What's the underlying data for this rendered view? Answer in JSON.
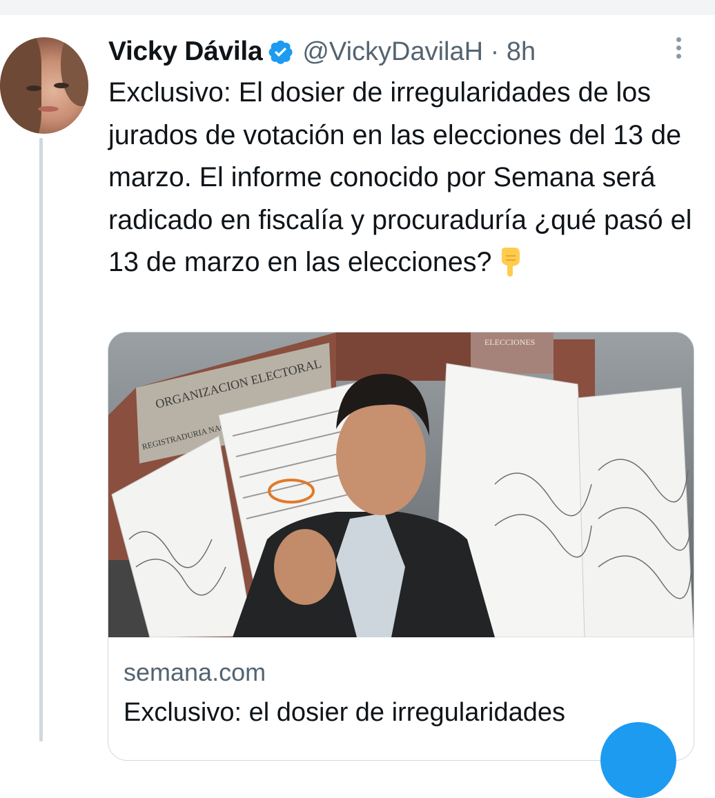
{
  "tweet": {
    "author_name": "Vicky Dávila",
    "handle_time": "@VickyDavilaH · 8h",
    "text": "Exclusivo: El dosier de irregularidades de los jurados de votación en las elecciones del 13 de marzo. El informe conocido por Semana será radicado en fiscalía y procuraduría ¿qué pasó el 13 de marzo en las elecciones?",
    "emoji": "pointing-down-emoji"
  },
  "card": {
    "image_sign_1": "ORGANIZACION ELECTORAL",
    "image_sign_2": "REGISTRADURIA NACIONAL DEL ESTADO CIVIL",
    "image_banner": "ELECCIONES",
    "domain": "semana.com",
    "title": "Exclusivo: el dosier de irregularidades"
  },
  "colors": {
    "text": "#0f1419",
    "secondary": "#536471",
    "verified": "#1d9bf0",
    "border": "#cfd9de"
  },
  "icons": [
    "verified-badge-icon",
    "more-options-icon",
    "pointing-down-emoji",
    "compose-fab-icon"
  ]
}
